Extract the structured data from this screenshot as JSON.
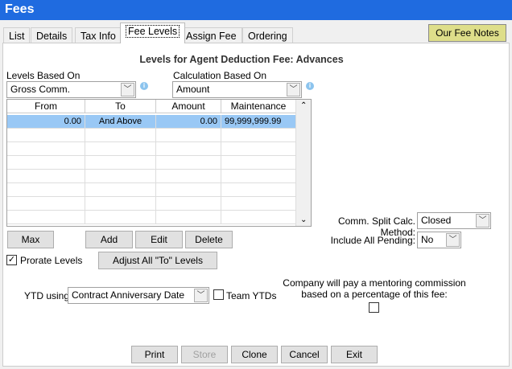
{
  "window": {
    "title": "Fees"
  },
  "tabs": [
    {
      "label": "List"
    },
    {
      "label": "Details"
    },
    {
      "label": "Tax Info"
    },
    {
      "label": "Fee Levels",
      "active": true
    },
    {
      "label": "Assign Fee"
    },
    {
      "label": "Ordering"
    }
  ],
  "notes_button": "Our Fee Notes",
  "heading": "Levels for Agent Deduction Fee: Advances",
  "levels_based_on": {
    "label": "Levels Based On",
    "value": "Gross Comm."
  },
  "calc_based_on": {
    "label": "Calculation Based On",
    "value": "Amount"
  },
  "grid": {
    "columns": [
      "From",
      "To",
      "Amount",
      "Maintenance"
    ],
    "rows": [
      [
        "0.00",
        "And Above",
        "0.00",
        "99,999,999.99"
      ]
    ]
  },
  "comm_split": {
    "label": "Comm. Split Calc. Method:",
    "value": "Closed"
  },
  "include_pending": {
    "label": "Include All Pending:",
    "value": "No"
  },
  "buttons": {
    "max": "Max",
    "add": "Add",
    "edit": "Edit",
    "delete": "Delete",
    "adjust": "Adjust All \"To\" Levels"
  },
  "prorate": {
    "label": "Prorate Levels",
    "checked": true
  },
  "ytd": {
    "label": "YTD using:",
    "value": "Contract Anniversary Date"
  },
  "team_ytds": {
    "label": "Team YTDs",
    "checked": false
  },
  "mentoring": {
    "line1": "Company will pay a mentoring commission",
    "line2": "based on a percentage of this fee:",
    "checked": false
  },
  "footer": {
    "print": "Print",
    "store": "Store",
    "clone": "Clone",
    "cancel": "Cancel",
    "exit": "Exit"
  },
  "colors": {
    "titlebar": "#1f6be0",
    "notes_button": "#dede8a",
    "selected_row": "#99c8f5"
  }
}
